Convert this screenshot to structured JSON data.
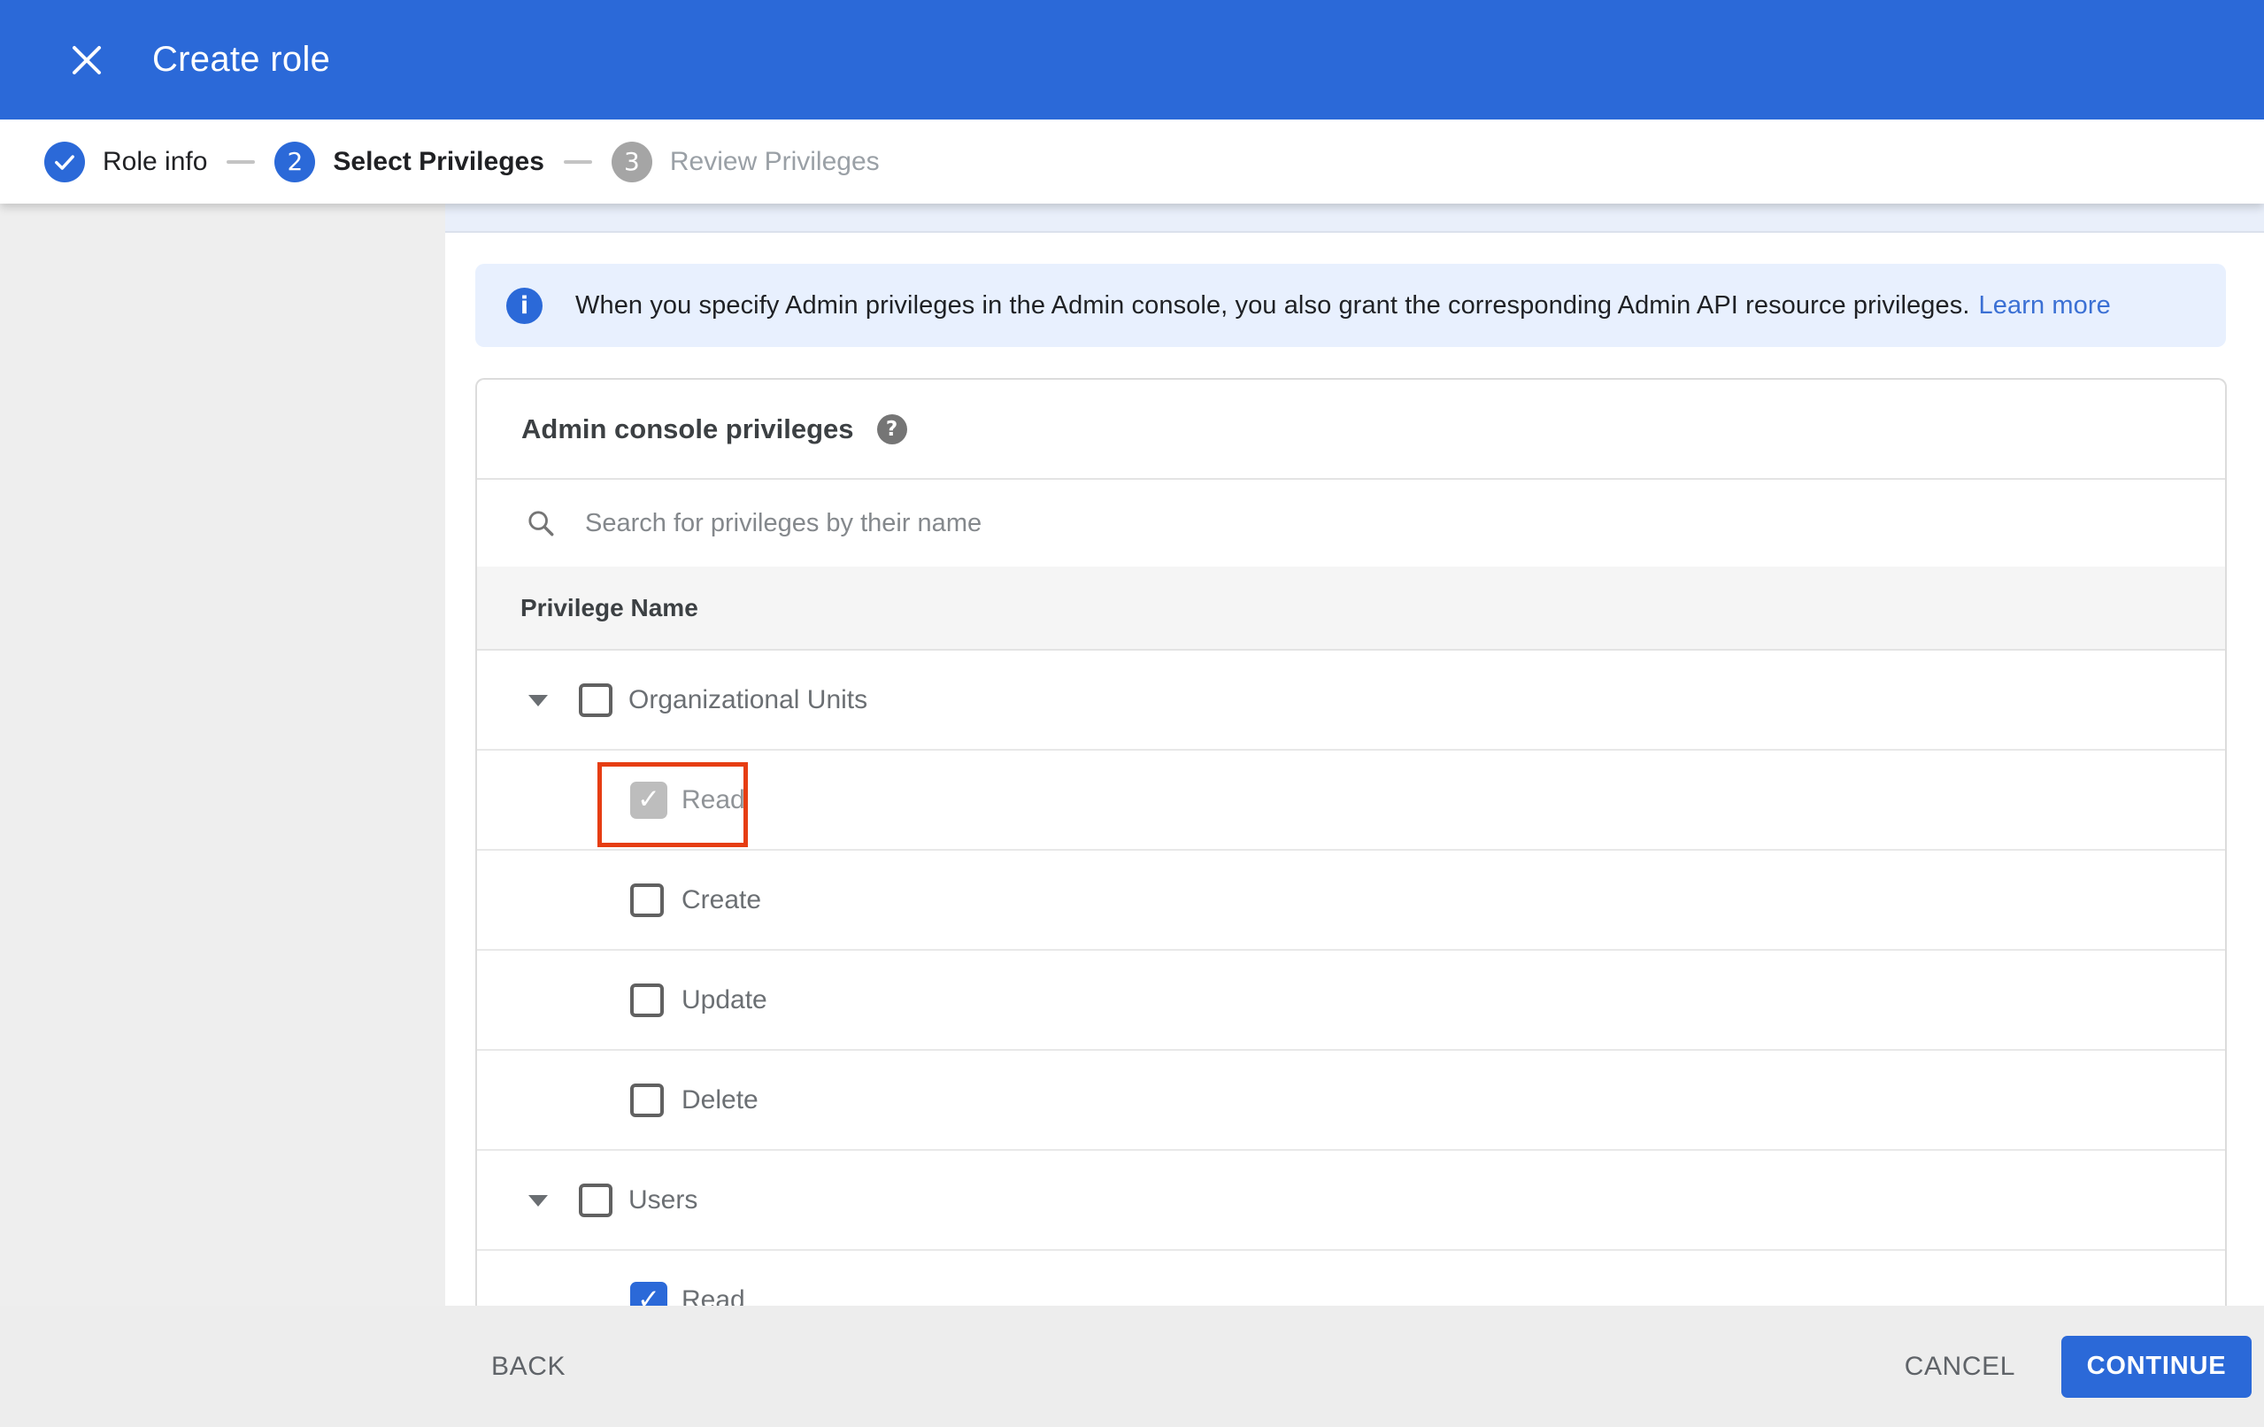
{
  "header": {
    "title": "Create role"
  },
  "stepper": {
    "steps": [
      {
        "label": "Role info",
        "state": "completed",
        "marker": "check"
      },
      {
        "label": "Select Privileges",
        "state": "active",
        "number": "2"
      },
      {
        "label": "Review Privileges",
        "state": "upcoming",
        "number": "3"
      }
    ]
  },
  "banner": {
    "text": "When you specify Admin privileges in the Admin console, you also grant the corresponding Admin API resource privileges.",
    "link_label": "Learn more"
  },
  "privileges": {
    "title": "Admin console privileges",
    "search_placeholder": "Search for privileges by their name",
    "column_header": "Privilege Name",
    "rows": [
      {
        "label": "Organizational Units",
        "type": "group",
        "expanded": true,
        "checked": false
      },
      {
        "label": "Read",
        "type": "child",
        "checked": true,
        "disabled": true,
        "highlighted": true
      },
      {
        "label": "Create",
        "type": "child",
        "checked": false
      },
      {
        "label": "Update",
        "type": "child",
        "checked": false
      },
      {
        "label": "Delete",
        "type": "child",
        "checked": false
      },
      {
        "label": "Users",
        "type": "group",
        "expanded": true,
        "checked": false
      },
      {
        "label": "Read",
        "type": "child",
        "checked": true,
        "partially_visible": true
      }
    ],
    "check_glyph": "✓"
  },
  "footer": {
    "back_label": "BACK",
    "cancel_label": "CANCEL",
    "continue_label": "CONTINUE"
  },
  "colors": {
    "accent_blue": "#2b69d8",
    "banner_bg": "#e8f0fe",
    "highlight_red": "#e63d12",
    "sidebar_gray": "#eeeeee",
    "footer_gray": "#ededed"
  }
}
